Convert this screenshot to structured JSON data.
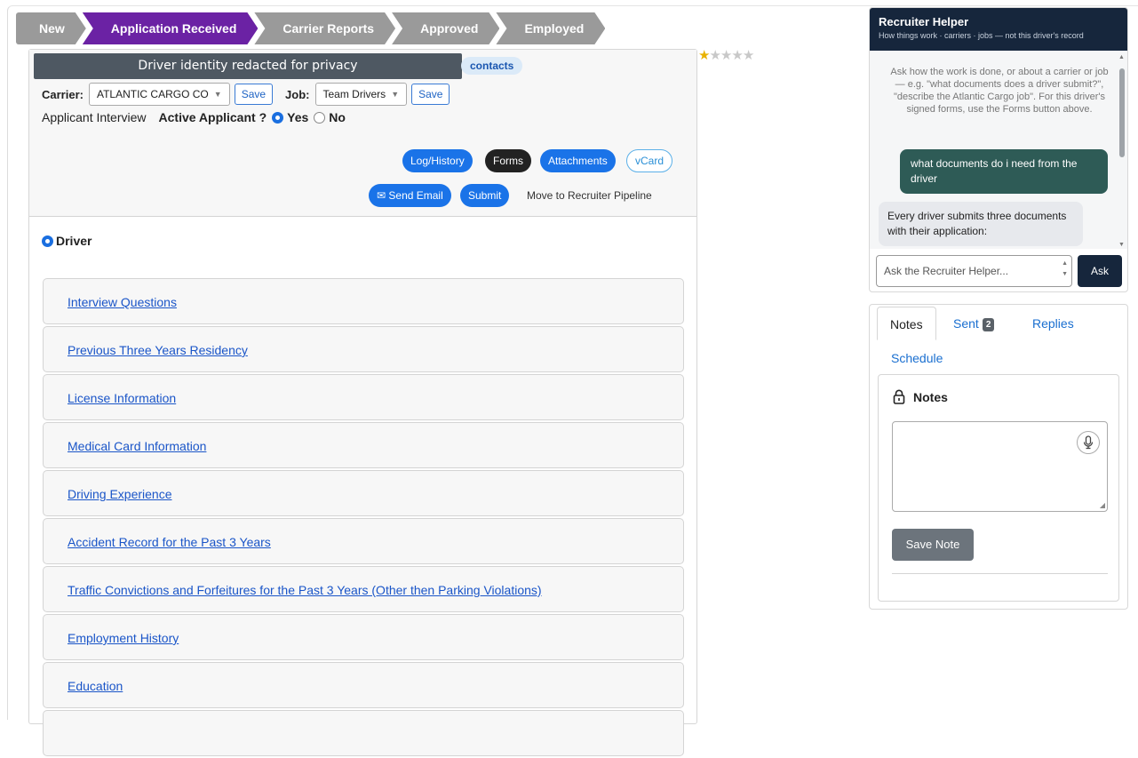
{
  "pipeline": {
    "steps": [
      "New",
      "Application Received",
      "Carrier Reports",
      "Approved",
      "Employed"
    ],
    "active_index": 1,
    "active_color": "#6b22a4"
  },
  "rating": {
    "value": 1,
    "max": 5
  },
  "header": {
    "redacted_banner": "Driver identity redacted for privacy",
    "contacts_label": "contacts",
    "carrier_label": "Carrier:",
    "carrier_value": "ATLANTIC CARGO CO",
    "carrier_save": "Save",
    "job_label": "Job:",
    "job_value": "Team Drivers",
    "job_save": "Save",
    "interview_label": "Applicant Interview",
    "active_label": "Active Applicant ?",
    "yes_label": "Yes",
    "no_label": "No",
    "active_selected": "Yes"
  },
  "actions": {
    "log_history": "Log/History",
    "forms": "Forms",
    "attachments": "Attachments",
    "vcard": "vCard",
    "send_email": "✉ Send Email",
    "submit": "Submit",
    "move_pipeline": "Move to Recruiter Pipeline"
  },
  "driver_label": "Driver",
  "sections": [
    "Interview Questions",
    "Previous Three Years Residency",
    "License Information",
    "Medical Card Information",
    "Driving Experience",
    "Accident Record for the Past 3 Years",
    "Traffic Convictions and Forfeitures for the Past 3 Years (Other then Parking Violations)",
    "Employment History",
    "Education"
  ],
  "helper": {
    "title": "Recruiter Helper",
    "subtitle": "How things work · carriers · jobs — not this driver's record",
    "hint": "Ask how the work is done, or about a carrier or job — e.g. \"what documents does a driver submit?\", \"describe the Atlantic Cargo job\". For this driver's signed forms, use the Forms button above.",
    "user_message": "what documents do i need from the driver",
    "bot_message": "Every driver submits three documents with their application:",
    "input_placeholder": "Ask the Recruiter Helper...",
    "ask_button": "Ask",
    "header_color": "#16263c"
  },
  "notes": {
    "tabs": [
      "Notes",
      "Sent",
      "Replies",
      "Schedule"
    ],
    "sent_count": "2",
    "title": "Notes",
    "save_button": "Save Note"
  }
}
